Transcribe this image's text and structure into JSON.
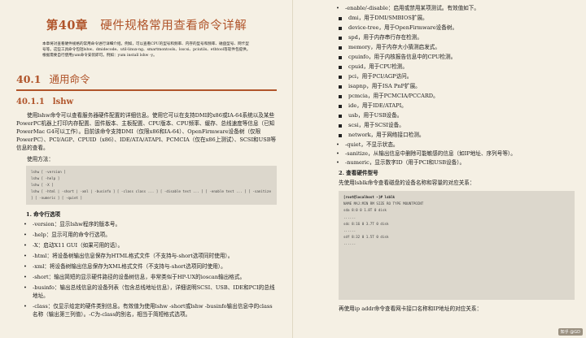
{
  "left": {
    "chapter_label": "第40章",
    "chapter_title": "硬件规格常用查看命令详解",
    "abstract": "本章将对查看硬件规格的常用命令进行详细介绍。例如，可以查看CPU的型号和频率、内存的型号和频率、磁盘型号、网卡型号等。这些工具命令包括lshw、dmidecode、util-linux-ng、smartmontools、lsscsi、pciutils、ethtool等软件包提供。根据需要自行使用yum命令安装即可。例如：yum install lshw -y。",
    "section_num": "40.1",
    "section_title": "通用命令",
    "subsection_num": "40.1.1",
    "subsection_title": "lshw",
    "intro": "使用lshw命令可以查看服务器硬件配置的详细信息。使用它可以在支持DMI的x86或IA-64系统以及某些PowerPC机器上打印内存配置、固件版本、主板配置、CPU版本、CPU频率、缓存、总线速度等信息（已知PowerMac G4可以工作）。目前该命令支持DMI（仅限x86和IA-64）、OpenFirmware设备树（仅限PowerPC）、PCI/AGP、CPUID（x86）、IDE/ATA/ATAPI、PCMCIA（仅在x86上测试）、SCSI和USB等信息的查看。",
    "usage_label": "使用方法：",
    "code_lines": [
      "lshw [ -version ]",
      "lshw [ -help ]",
      "lshw [ -X ]",
      "lshw [ -html | -short | -xml | -businfo ] [ -class class ... ] [ -disable test ... ] [ -enable test ... ] [ -sanitize ] [ -numeric ] [ -quiet ]"
    ],
    "options_heading": "1. 命令行选项",
    "options": [
      "-version：显示lshw程序的版本号。",
      "-help：显示可用的命令行选项。",
      "-X：启动X11 GUI（如果可用的话）。",
      "-html：将设备树输出信息保存为HTML格式文件（不支持与-short选项同时使用）。",
      "-xml：将设备树输出信息保存为XML格式文件（不支持与-short选项同时使用）。",
      "-short：输出简短的显示硬件路径的设备树信息，非常类似于HP-UX的ioscan输出格式。",
      "-businfo：输出总线信息的设备列表（包含总线地址信息），详细说明SCSI、USB、IDE和PCI的总线地址。",
      "-class：仅显示给定的硬件类别信息。有效值为使用lshw -short或lshw -businfo输出信息中的class名称（输出第三列值）。-C为-class的别名，相当于简短格式选项。"
    ]
  },
  "right": {
    "top_line": "-enable/-disable：启用或禁用某项测试。有效值如下。",
    "tests": [
      "dmi，用于DMI/SMBIOS扩展。",
      "device-tree，用于OpenFirmware设备树。",
      "spd，用于内存串行存在检测。",
      "memory，用于内存大小猜测启发式。",
      "cpuinfo，用于内核报告信息中的CPU检测。",
      "cpuid，用于CPU检测。",
      "pci，用于PCI/AGP访问。",
      "isapnp，用于ISA PnP扩展。",
      "pcmcia，用于PCMCIA/PCCARD。",
      "ide，用于IDE/ATAPI。",
      "usb，用于USB设备。",
      "scsi，用于SCSI设备。",
      "network，用于网络接口检测。"
    ],
    "more": [
      "-quiet，不显示状态。",
      "-sanitize，从输出信息中删除可能敏感的信息（如IP地址、序列号等）。",
      "-numeric，显示数字ID（用于PCI和USB设备）。"
    ],
    "example_heading": "2. 查看硬件型号",
    "example_intro": "先使用lsblk命令查看磁盘的设备名称和容量的对应关系：",
    "term_prompt": "[root@localhost ~]# lsblk",
    "term_lines": [
      "NAME MAJ:MIN RM SIZE RO TYPE MOUNTPOINT",
      "sda 8:0 0 1.8T 0 disk",
      "......",
      "sdc 8:16 0 3.7T 0 disk",
      "......",
      "sdf 8:32 0 1.5T 0 disk",
      "......"
    ],
    "after": "再使用ip addr命令查看网卡接口名称和IP地址的对应关系："
  },
  "watermark": "知乎 @GD"
}
